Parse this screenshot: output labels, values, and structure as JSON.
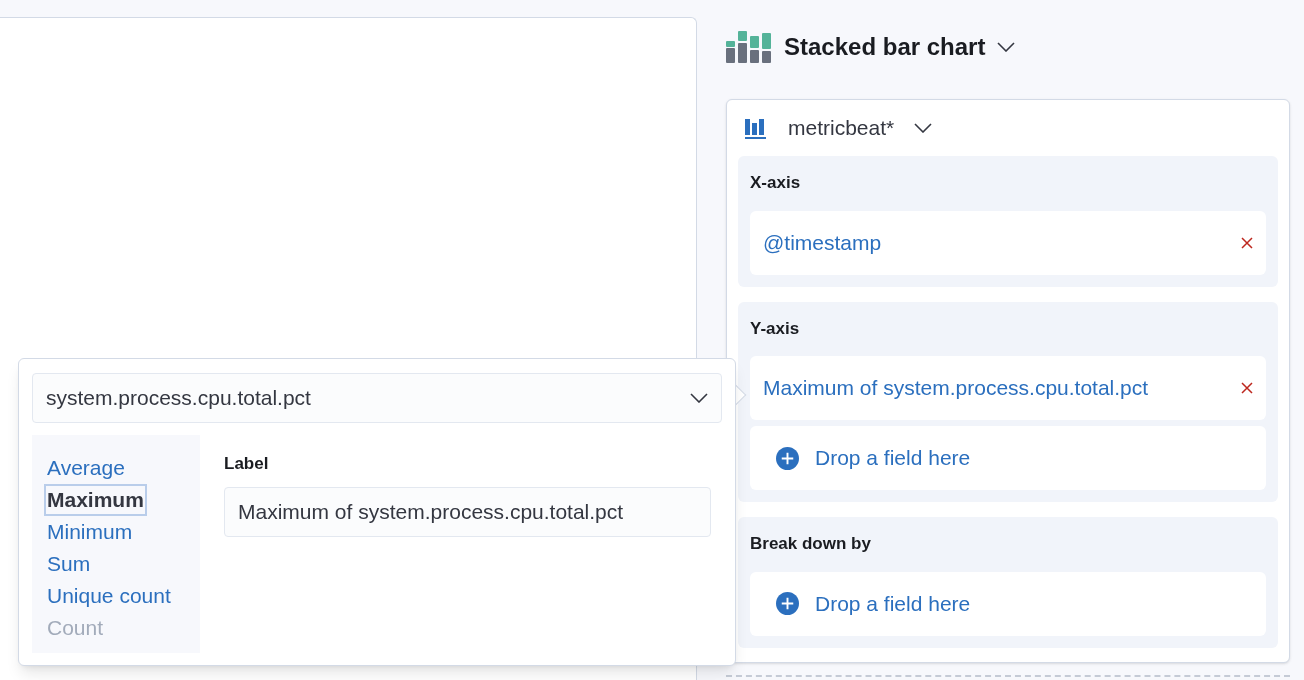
{
  "chart_type": {
    "title": "Stacked bar chart"
  },
  "index_pattern": {
    "name": "metricbeat*"
  },
  "groups": [
    {
      "title": "X-axis",
      "items": [
        {
          "kind": "field",
          "label": "@timestamp"
        }
      ]
    },
    {
      "title": "Y-axis",
      "items": [
        {
          "kind": "field",
          "label": "Maximum of system.process.cpu.total.pct"
        },
        {
          "kind": "empty",
          "label": "Drop a field here"
        }
      ]
    },
    {
      "title": "Break down by",
      "items": [
        {
          "kind": "empty",
          "label": "Drop a field here"
        }
      ]
    }
  ],
  "popover": {
    "field": "system.process.cpu.total.pct",
    "functions": [
      {
        "label": "Average",
        "selected": false,
        "disabled": false
      },
      {
        "label": "Maximum",
        "selected": true,
        "disabled": false
      },
      {
        "label": "Minimum",
        "selected": false,
        "disabled": false
      },
      {
        "label": "Sum",
        "selected": false,
        "disabled": false
      },
      {
        "label": "Unique count",
        "selected": false,
        "disabled": false
      },
      {
        "label": "Count",
        "selected": false,
        "disabled": true
      }
    ],
    "label_title": "Label",
    "label_value": "Maximum of system.process.cpu.total.pct"
  }
}
